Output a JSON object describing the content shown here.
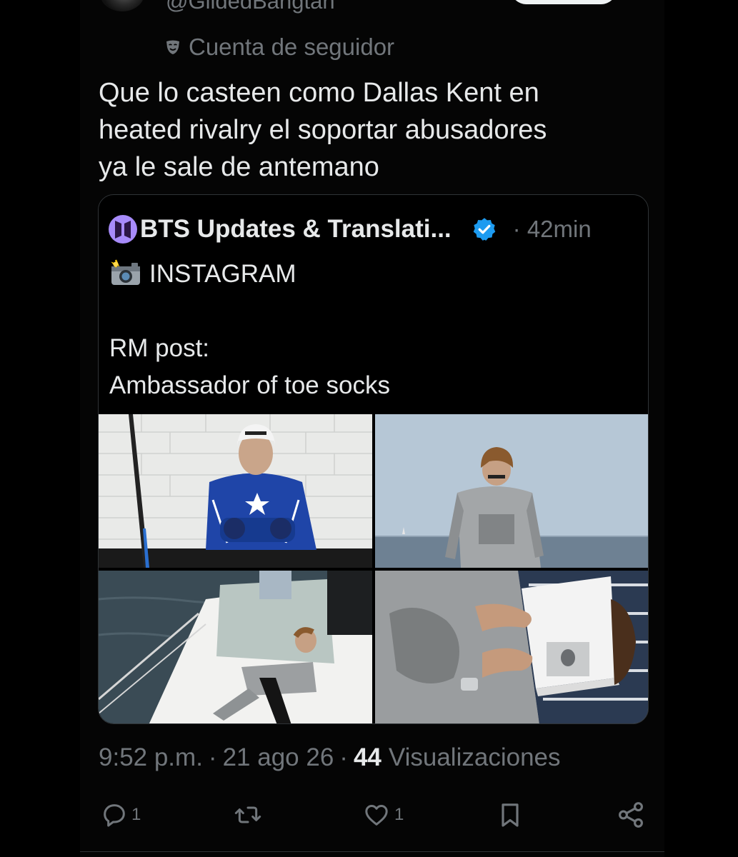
{
  "author": {
    "handle": "@GildedBangtan",
    "account_label": "Cuenta de seguidor"
  },
  "tweet": {
    "text": "Que lo casteen como Dallas Kent en\nheated rivalry el soportar abusadores\nya le sale de antemano"
  },
  "quote": {
    "name": "BTS Updates & Translati...",
    "time": "· 42min",
    "lines": [
      "INSTAGRAM",
      "",
      "RM post:",
      "Ambassador of toe socks"
    ]
  },
  "meta": {
    "time": "9:52 p.m.",
    "date": "21 ago 26",
    "views_count": "44",
    "views_label": "Visualizaciones"
  },
  "actions": {
    "replies": "1",
    "likes": "1"
  },
  "colors": {
    "background": "#000000",
    "text": "#e7e9ea",
    "muted": "#71767b",
    "verified": "#1d9bf0",
    "border": "#2f3336"
  }
}
